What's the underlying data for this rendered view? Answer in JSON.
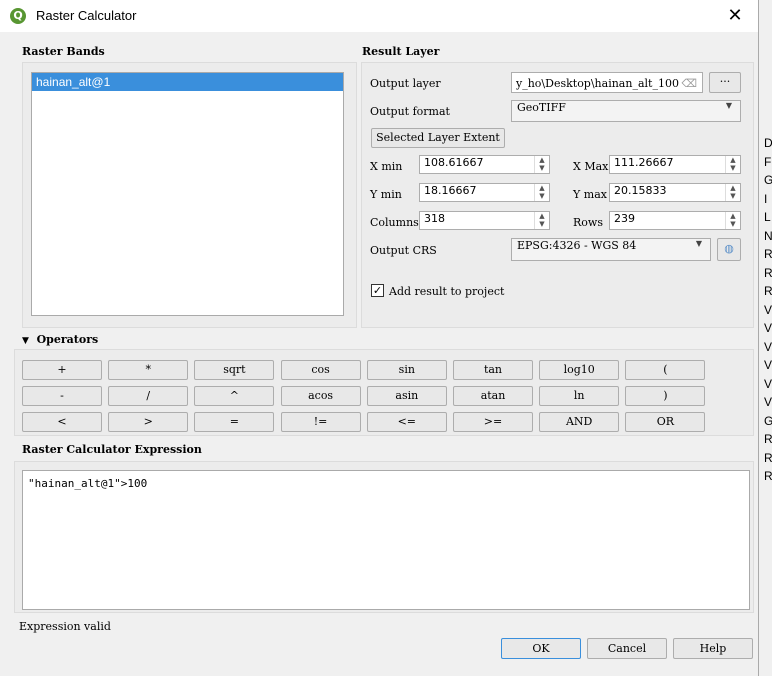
{
  "window": {
    "title": "Raster Calculator",
    "close": "✕"
  },
  "raster_bands": {
    "heading": "Raster Bands",
    "items": [
      "hainan_alt@1"
    ]
  },
  "result_layer": {
    "heading": "Result Layer",
    "output_layer_label": "Output layer",
    "output_layer_value": "y_ho\\Desktop\\hainan_alt_100",
    "browse": "···",
    "output_format_label": "Output format",
    "output_format_value": "GeoTIFF",
    "extent_button": "Selected Layer Extent",
    "xmin_label": "X min",
    "xmin": "108.61667",
    "xmax_label": "X Max",
    "xmax": "111.26667",
    "ymin_label": "Y min",
    "ymin": "18.16667",
    "ymax_label": "Y max",
    "ymax": "20.15833",
    "columns_label": "Columns",
    "columns": "318",
    "rows_label": "Rows",
    "rows": "239",
    "crs_label": "Output CRS",
    "crs_value": "EPSG:4326 - WGS 84",
    "add_result_label": "Add result to project",
    "add_result_checked": true
  },
  "operators": {
    "heading": "Operators",
    "rows": [
      [
        "+",
        "*",
        "sqrt",
        "cos",
        "sin",
        "tan",
        "log10",
        "("
      ],
      [
        "-",
        "/",
        "^",
        "acos",
        "asin",
        "atan",
        "ln",
        ")"
      ],
      [
        "<",
        ">",
        "=",
        "!=",
        "<=",
        ">=",
        "AND",
        "OR"
      ]
    ]
  },
  "expression": {
    "heading": "Raster Calculator Expression",
    "value": "\"hainan_alt@1\">100",
    "status": "Expression valid"
  },
  "buttons": {
    "ok": "OK",
    "cancel": "Cancel",
    "help": "Help"
  },
  "background_strip": [
    "D",
    "F",
    "G",
    "I",
    "L",
    "N",
    "R",
    "R",
    "R",
    "V",
    "V",
    "V",
    "V",
    "V",
    "V",
    "G",
    "R",
    "R",
    "R"
  ]
}
